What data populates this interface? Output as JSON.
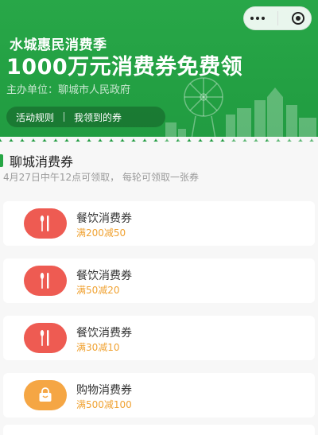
{
  "banner": {
    "title_line1": "水城惠民消费季",
    "title_line2": "1000万元消费券免费领",
    "sponsor": "主办单位：聊城市人民政府",
    "actions": {
      "rules_label": "活动规则",
      "my_coupons_label": "我领到的券"
    },
    "background_color": "#23a043"
  },
  "capsule": {
    "more_icon": "more-dots-icon",
    "close_icon": "close-circle-icon"
  },
  "section": {
    "title": "聊城消费券",
    "subtitle": "4月27日中午12点可领取，  每轮可领取一张券",
    "accent_color": "#27a645"
  },
  "coupons": [
    {
      "name": "餐饮消费券",
      "deal": "满200减50",
      "icon": "fork-knife-icon",
      "color": "#ee5b52"
    },
    {
      "name": "餐饮消费券",
      "deal": "满50减20",
      "icon": "fork-knife-icon",
      "color": "#ee5b52"
    },
    {
      "name": "餐饮消费券",
      "deal": "满30减10",
      "icon": "fork-knife-icon",
      "color": "#ee5b52"
    },
    {
      "name": "购物消费券",
      "deal": "满500减100",
      "icon": "shopping-bag-icon",
      "color": "#f5a644"
    }
  ]
}
